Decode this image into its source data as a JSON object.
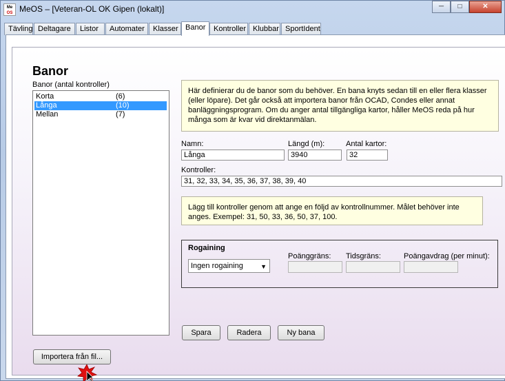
{
  "window": {
    "title": "MeOS – [Veteran-OL OK Gipen (lokalt)]",
    "icon_top": "Me",
    "icon_bottom": "OS"
  },
  "tabs": [
    {
      "label": "Tävling"
    },
    {
      "label": "Deltagare"
    },
    {
      "label": "Listor"
    },
    {
      "label": "Automater"
    },
    {
      "label": "Klasser"
    },
    {
      "label": "Banor",
      "active": true
    },
    {
      "label": "Kontroller"
    },
    {
      "label": "Klubbar"
    },
    {
      "label": "SportIdent"
    }
  ],
  "page": {
    "title": "Banor",
    "list_label": "Banor (antal kontroller)",
    "courses": [
      {
        "name": "Korta",
        "count": "(6)"
      },
      {
        "name": "Långa",
        "count": "(10)",
        "selected": true
      },
      {
        "name": "Mellan",
        "count": "(7)"
      }
    ],
    "info_text": "Här definierar du de banor som du behöver. En bana knyts sedan till en eller flera klasser (eller löpare). Det går också att importera banor från OCAD, Condes eller annat banläggningsprogram. Om du anger antal tillgängliga kartor, håller MeOS reda på hur många som är kvar vid direktanmälan.",
    "name_label": "Namn:",
    "name_value": "Långa",
    "length_label": "Längd (m):",
    "length_value": "3940",
    "maps_label": "Antal kartor:",
    "maps_value": "32",
    "controls_label": "Kontroller:",
    "controls_value": "31, 32, 33, 34, 35, 36, 37, 38, 39, 40",
    "hint_text": "Lägg till kontroller genom att ange en följd av kontrollnummer. Målet behöver inte anges. Exempel: 31, 50, 33, 36, 50, 37, 100.",
    "rogaining": {
      "title": "Rogaining",
      "mode": "Ingen rogaining",
      "points_label": "Poänggräns:",
      "time_label": "Tidsgräns:",
      "deduction_label": "Poängavdrag (per minut):"
    },
    "buttons": {
      "save": "Spara",
      "delete": "Radera",
      "new": "Ny bana",
      "import": "Importera från fil..."
    }
  },
  "colors": {
    "selection": "#3399ff",
    "info_background": "#ffffe1"
  }
}
